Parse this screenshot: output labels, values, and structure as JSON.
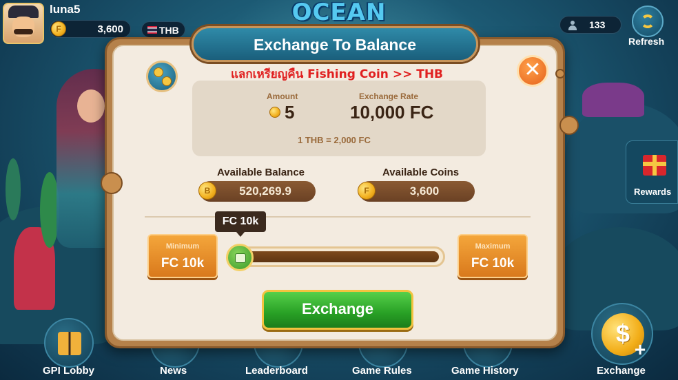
{
  "header": {
    "username": "luna5",
    "coin_balance": "3,600",
    "currency": "THB",
    "logo_text": "OCEAN",
    "online_count": "133",
    "refresh_label": "Refresh"
  },
  "side": {
    "rewards_label": "Rewards"
  },
  "modal": {
    "title": "Exchange To Balance",
    "subtitle": "แลกเหรียญคืน Fishing Coin >> THB",
    "close_symbol": "✕",
    "amount_label": "Amount",
    "amount_value": "5",
    "rate_label": "Exchange Rate",
    "rate_value": "10,000 FC",
    "rate_note": "1 THB = 2,000 FC",
    "available_balance_label": "Available Balance",
    "available_balance_value": "520,269.9",
    "available_coins_label": "Available Coins",
    "available_coins_value": "3,600",
    "slider": {
      "tooltip": "FC 10k",
      "position": 0
    },
    "minimum": {
      "caption": "Minimum",
      "amount": "FC 10k"
    },
    "maximum": {
      "caption": "Maximum",
      "amount": "FC 10k"
    },
    "exchange_button": "Exchange"
  },
  "nav": {
    "items": [
      {
        "label": "GPI Lobby",
        "icon": "book-icon"
      },
      {
        "label": "News",
        "icon": "news-icon"
      },
      {
        "label": "Leaderboard",
        "icon": "trophy-icon"
      },
      {
        "label": "Game Rules",
        "icon": "rules-icon"
      },
      {
        "label": "Game History",
        "icon": "history-icon"
      },
      {
        "label": "Exchange",
        "icon": "dollar-coin-icon"
      }
    ]
  },
  "colors": {
    "primary_banner": "#1a5f7c",
    "accent_orange": "#e5621c",
    "confirm_green": "#28a025",
    "subtitle_red": "#e02020"
  }
}
